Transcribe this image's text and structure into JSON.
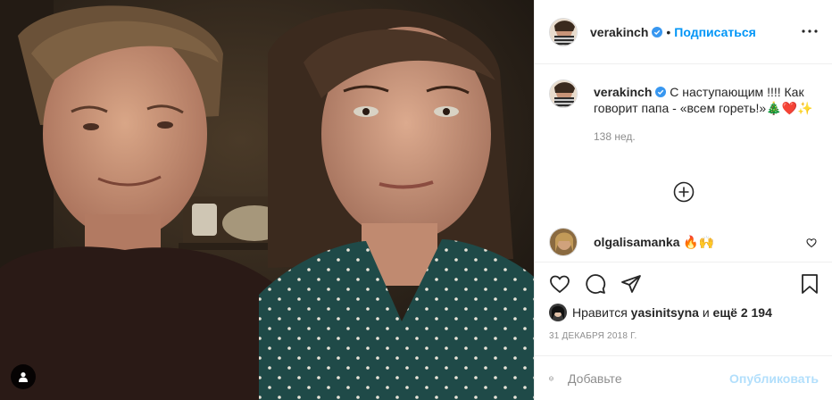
{
  "header": {
    "username": "verakinch",
    "separator": "•",
    "follow_label": "Подписаться",
    "more_icon": "more-horizontal-icon"
  },
  "caption": {
    "username": "verakinch",
    "text": "С наступающим !!!! Как говорит папа - «всем гореть!»🎄❤️✨",
    "time": "138 нед."
  },
  "comment": {
    "username": "olgalisamanka",
    "text": "🔥🙌"
  },
  "likes": {
    "prefix": "Нравится",
    "liker": "yasinitsyna",
    "middle": "и",
    "others": "ещё 2 194"
  },
  "date": "31 декабря 2018 г.",
  "add_comment": {
    "placeholder": "Добавьте",
    "publish_label": "Опубликовать"
  },
  "colors": {
    "accent": "#0095f6",
    "publish_disabled": "#b2dffc",
    "secondary_text": "#8e8e8e",
    "border": "#efefef",
    "verified": "#3897f0"
  }
}
